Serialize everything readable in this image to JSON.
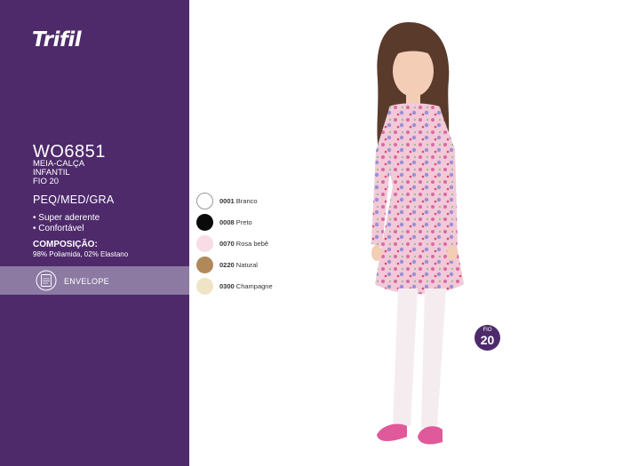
{
  "brand": {
    "logo": "Trifil"
  },
  "product": {
    "code": "WO6851",
    "description_lines": [
      "MEIA-CALÇA",
      "INFANTIL",
      "FIO 20"
    ],
    "sizes": "PEQ/MED/GRA",
    "features": [
      "• Super aderente",
      "• Confortável"
    ],
    "composition_title": "COMPOSIÇÃO:",
    "composition_text": "98% Poliamida, 02% Elastano",
    "packaging_label": "ENVELOPE",
    "packaging_icon": "envelope-icon"
  },
  "colors": [
    {
      "code": "0001",
      "name": "Branco",
      "hex": "#ffffff"
    },
    {
      "code": "0008",
      "name": "Preto",
      "hex": "#0a0a0a"
    },
    {
      "code": "0070",
      "name": "Rosa bebê",
      "hex": "#f8dce6"
    },
    {
      "code": "0220",
      "name": "Natural",
      "hex": "#b18859"
    },
    {
      "code": "0300",
      "name": "Champagne",
      "hex": "#efe4c6"
    }
  ],
  "badge": {
    "label": "FIO",
    "number": "20"
  },
  "theme": {
    "sidebar": "#4e2a6b",
    "band": "#8c7aa3",
    "accent": "#4e2a6b"
  }
}
